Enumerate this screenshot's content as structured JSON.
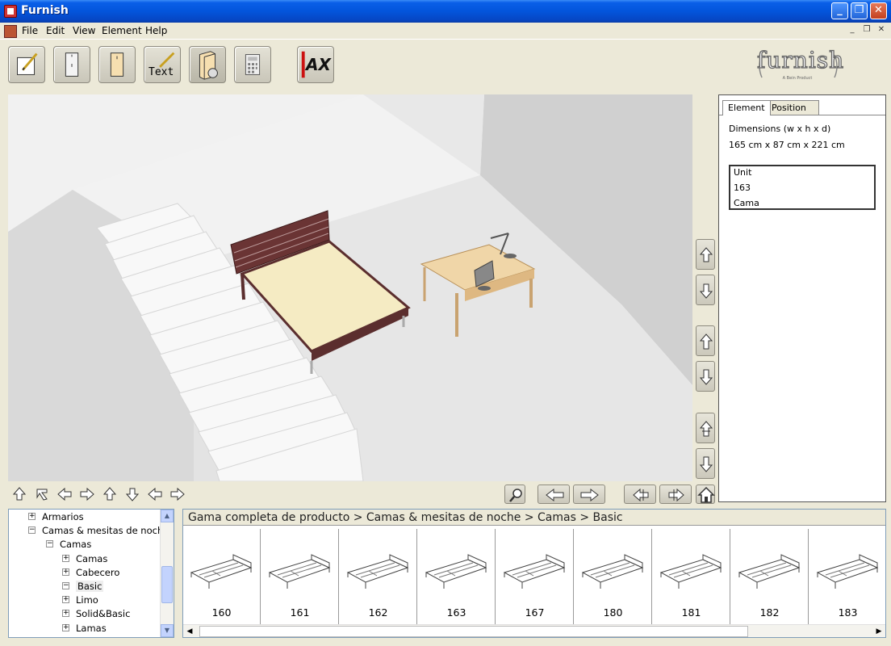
{
  "window": {
    "title": "Furnish"
  },
  "menu": [
    "File",
    "Edit",
    "View",
    "Element",
    "Help"
  ],
  "toolbar": {
    "text_tool_label": "Text",
    "cad_label": "AX",
    "logo": "furnish",
    "logo_sub": "A Bein Product"
  },
  "props": {
    "tabs": [
      "Element",
      "Position"
    ],
    "active_tab": "Element",
    "dimensions_label": "Dimensions (w x h x d)",
    "dimensions_value": "165 cm x 87 cm x 221 cm",
    "unit": [
      "Unit",
      "163",
      "Cama"
    ]
  },
  "tree": [
    {
      "label": "Armarios",
      "toggle": "+"
    },
    {
      "label": "Camas & mesitas de noche",
      "toggle": "−"
    },
    {
      "label": "Camas",
      "toggle": "−"
    },
    {
      "label": "Camas",
      "toggle": "+"
    },
    {
      "label": "Cabecero",
      "toggle": "+"
    },
    {
      "label": "Basic",
      "toggle": "−",
      "selected": true
    },
    {
      "label": "Limo",
      "toggle": "+"
    },
    {
      "label": "Solid&Basic",
      "toggle": "+"
    },
    {
      "label": "Lamas",
      "toggle": "+"
    }
  ],
  "catalog": {
    "breadcrumb": "Gama completa de producto > Camas & mesitas de noche > Camas > Basic",
    "items": [
      "160",
      "161",
      "162",
      "163",
      "167",
      "180",
      "181",
      "182",
      "183"
    ]
  },
  "colors": {
    "titlebar": "#0355db",
    "chrome": "#ece9d8",
    "bed_frame": "#5b2e2e",
    "desk": "#f0d6a8"
  }
}
